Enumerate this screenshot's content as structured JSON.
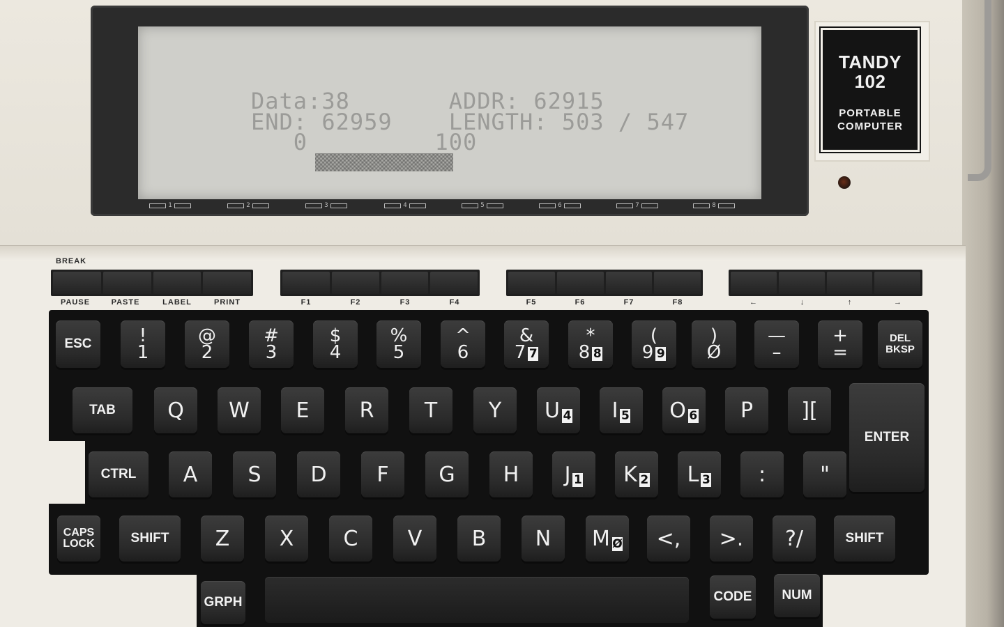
{
  "screen": {
    "lines": [
      "Data:38       ADDR: 62915",
      "END: 62959    LENGTH: 503 / 547",
      "   0         100"
    ],
    "progress_percent": 100,
    "fkey_labels": [
      "1",
      "2",
      "3",
      "4",
      "5",
      "6",
      "7",
      "8"
    ]
  },
  "badge": {
    "brand": "TANDY",
    "model": "102",
    "line1": "PORTABLE",
    "line2": "COMPUTER"
  },
  "function_row": {
    "break_label": "BREAK",
    "labels": [
      "PAUSE",
      "PASTE",
      "LABEL",
      "PRINT",
      "F1",
      "F2",
      "F3",
      "F4",
      "F5",
      "F6",
      "F7",
      "F8",
      "←",
      "↓",
      "↑",
      "→"
    ]
  },
  "keys": {
    "row1": [
      {
        "top": "ESC",
        "type": "lbl"
      },
      {
        "top": "!",
        "bottom": "1"
      },
      {
        "top": "@",
        "bottom": "2"
      },
      {
        "top": "#",
        "bottom": "3"
      },
      {
        "top": "$",
        "bottom": "4"
      },
      {
        "top": "%",
        "bottom": "5"
      },
      {
        "top": "^",
        "bottom": "6"
      },
      {
        "top": "&",
        "bottom": "7",
        "num": "7"
      },
      {
        "top": "*",
        "bottom": "8",
        "num": "8"
      },
      {
        "top": "(",
        "bottom": "9",
        "num": "9"
      },
      {
        "top": ")",
        "bottom": "Ø"
      },
      {
        "top": "—",
        "bottom": "–"
      },
      {
        "top": "+",
        "bottom": "="
      },
      {
        "top": "DEL",
        "bottom": "BKSP",
        "type": "small"
      }
    ],
    "row2": [
      "TAB",
      "Q",
      "W",
      "E",
      "R",
      "T",
      "Y",
      "U",
      "I",
      "O",
      "P",
      "]["
    ],
    "row2_nums": {
      "U": "4",
      "I": "5",
      "O": "6"
    },
    "row3": [
      "CTRL",
      "A",
      "S",
      "D",
      "F",
      "G",
      "H",
      "J",
      "K",
      "L",
      ":",
      "\""
    ],
    "row3_nums": {
      "J": "1",
      "K": "2",
      "L": "3"
    },
    "row4": [
      "CAPS LOCK",
      "SHIFT",
      "Z",
      "X",
      "C",
      "V",
      "B",
      "N",
      "M",
      "<,",
      ">.",
      "?/",
      "SHIFT"
    ],
    "row4_nums": {
      "M": "Ø"
    },
    "enter": "ENTER",
    "grph": "GRPH",
    "code": "CODE",
    "num": "NUM"
  }
}
